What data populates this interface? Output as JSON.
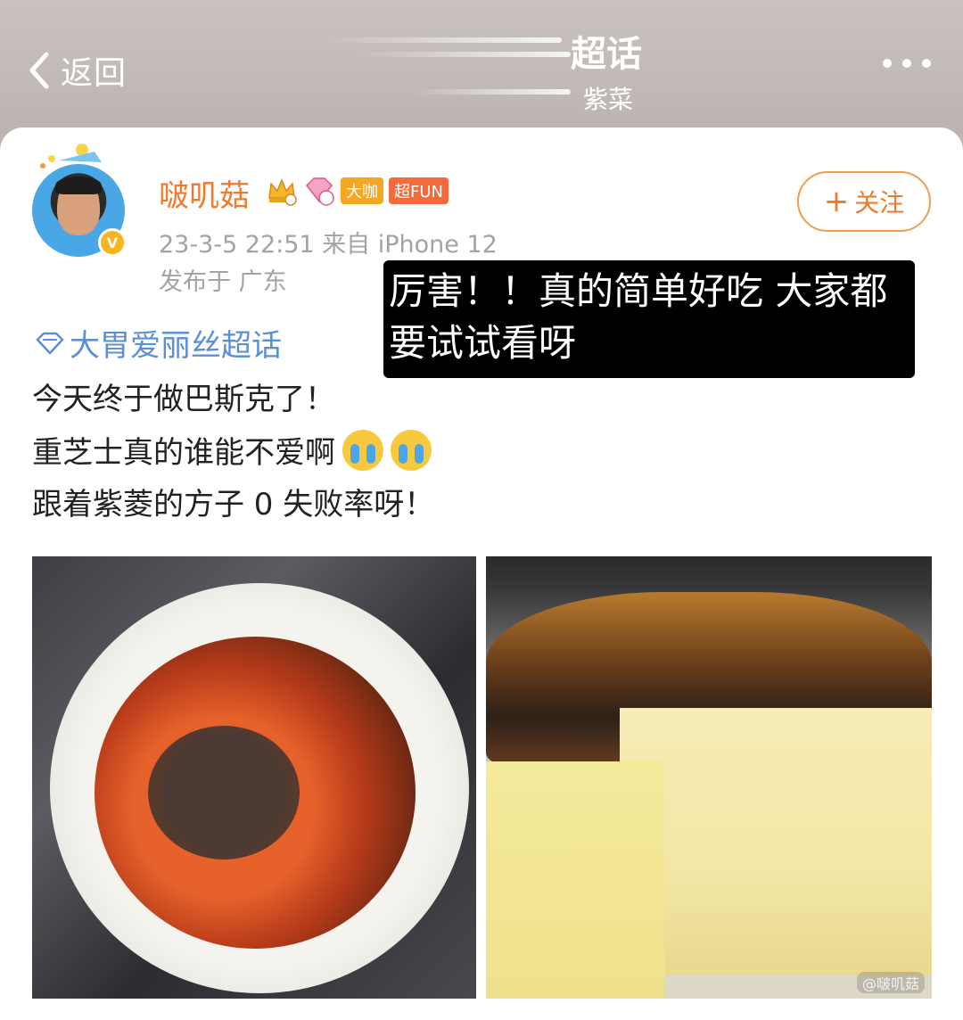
{
  "header": {
    "back_label": "返回",
    "title": "超话",
    "subtitle": "紫菜"
  },
  "post": {
    "username": "啵叽菇",
    "tags": [
      "大咖",
      "超FUN"
    ],
    "time_source": "23-3-5 22:51  来自 iPhone 12",
    "location": "发布于 广东",
    "follow_label": "关注",
    "topic": "大胃爱丽丝超话",
    "lines": [
      "今天终于做巴斯克了！",
      "重芝士真的谁能不爱啊",
      "跟着紫菱的方子 0 失败率呀！"
    ]
  },
  "overlay_text": "厉害！！真的简单好吃 大家都要试试看呀",
  "colors": {
    "accent": "#f07a2c",
    "topic": "#5b8fd6"
  },
  "icons": {
    "back": "chevron-left-icon",
    "more": "more-dots-icon",
    "verified": "verified-v-icon",
    "crown": "crown-badge-icon",
    "level": "level-badge-icon",
    "topic": "diamond-icon",
    "emoji": "crying-face-icon"
  }
}
